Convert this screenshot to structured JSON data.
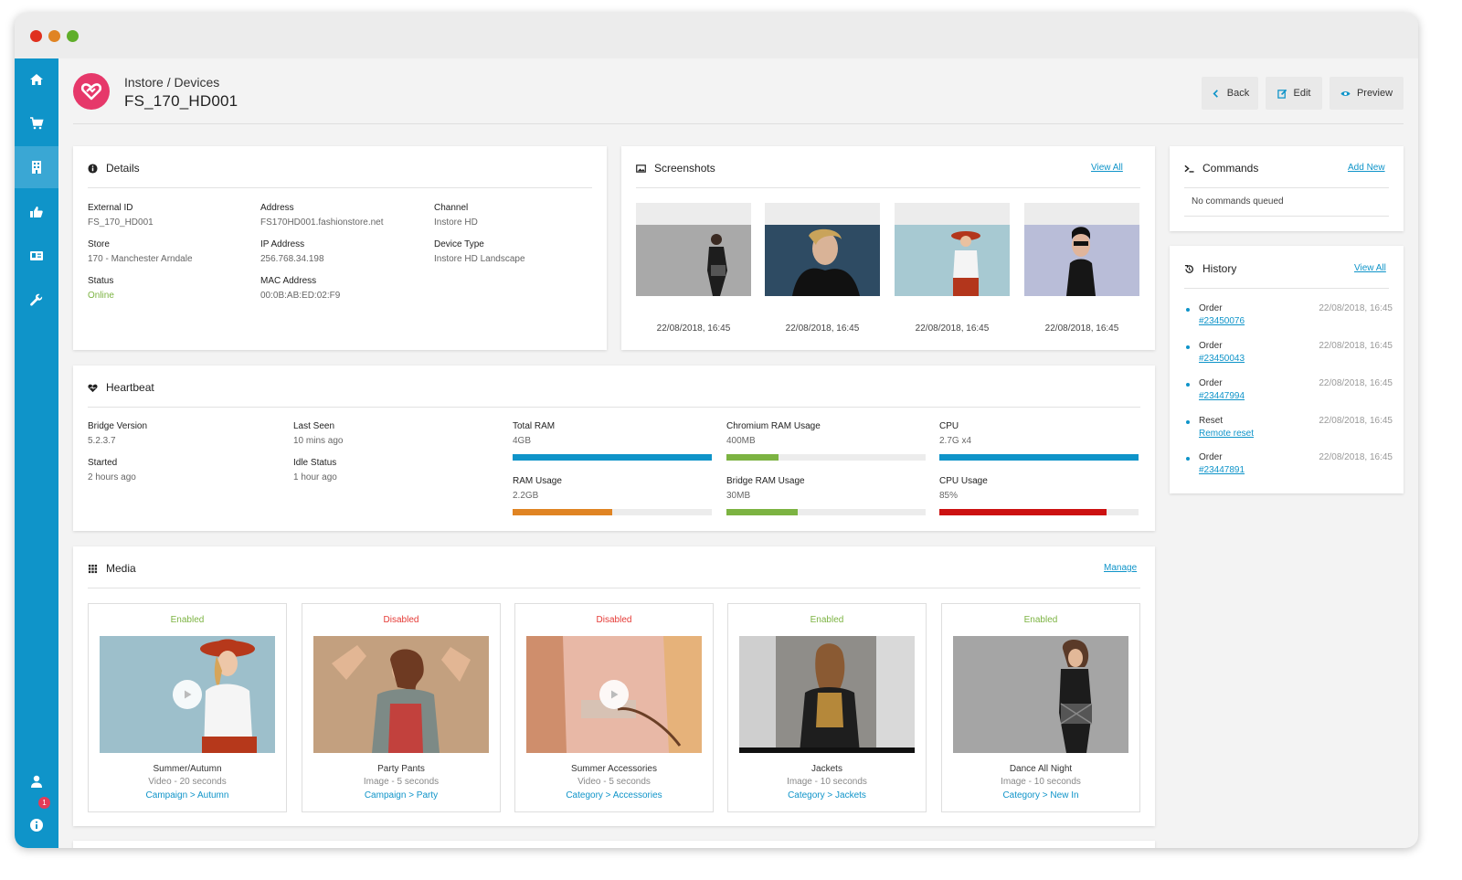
{
  "colors": {
    "accent": "#0f94c9",
    "brand": "#e6386a",
    "enabled": "#7cb342",
    "disabled": "#e53935",
    "orange": "#e08423",
    "red": "#cc1111"
  },
  "header": {
    "breadcrumb": "Instore / Devices",
    "title": "FS_170_HD001",
    "back_label": "Back",
    "edit_label": "Edit",
    "preview_label": "Preview"
  },
  "details": {
    "title": "Details",
    "external_id_label": "External ID",
    "external_id": "FS_170_HD001",
    "address_label": "Address",
    "address": "FS170HD001.fashionstore.net",
    "channel_label": "Channel",
    "channel": "Instore HD",
    "store_label": "Store",
    "store": "170 - Manchester Arndale",
    "ip_label": "IP Address",
    "ip": "256.768.34.198",
    "device_type_label": "Device Type",
    "device_type": "Instore HD Landscape",
    "status_label": "Status",
    "status": "Online",
    "mac_label": "MAC Address",
    "mac": "00:0B:AB:ED:02:F9"
  },
  "screenshots": {
    "title": "Screenshots",
    "view_all": "View All",
    "items": [
      {
        "date": "22/08/2018, 16:45"
      },
      {
        "date": "22/08/2018, 16:45"
      },
      {
        "date": "22/08/2018, 16:45"
      },
      {
        "date": "22/08/2018, 16:45"
      }
    ]
  },
  "commands": {
    "title": "Commands",
    "add_new": "Add New",
    "empty": "No commands queued"
  },
  "history": {
    "title": "History",
    "view_all": "View All",
    "items": [
      {
        "type": "Order",
        "ref": "#23450076",
        "time": "22/08/2018, 16:45"
      },
      {
        "type": "Order",
        "ref": "#23450043",
        "time": "22/08/2018, 16:45"
      },
      {
        "type": "Order",
        "ref": "#23447994",
        "time": "22/08/2018, 16:45"
      },
      {
        "type": "Reset",
        "ref": "Remote reset",
        "time": "22/08/2018, 16:45"
      },
      {
        "type": "Order",
        "ref": "#23447891",
        "time": "22/08/2018, 16:45"
      }
    ]
  },
  "heartbeat": {
    "title": "Heartbeat",
    "bridge_version_label": "Bridge Version",
    "bridge_version": "5.2.3.7",
    "last_seen_label": "Last Seen",
    "last_seen": "10 mins ago",
    "started_label": "Started",
    "started": "2 hours ago",
    "idle_label": "Idle Status",
    "idle": "1 hour ago",
    "total_ram_label": "Total RAM",
    "total_ram": "4GB",
    "total_ram_fill": 1.0,
    "chromium_label": "Chromium RAM Usage",
    "chromium": "400MB",
    "chromium_fill": 0.26,
    "cpu_label": "CPU",
    "cpu": "2.7G x4",
    "cpu_fill": 1.0,
    "ram_usage_label": "RAM Usage",
    "ram_usage": "2.2GB",
    "ram_usage_fill": 0.5,
    "bridge_ram_label": "Bridge RAM Usage",
    "bridge_ram": "30MB",
    "bridge_ram_fill": 0.36,
    "cpu_usage_label": "CPU Usage",
    "cpu_usage": "85%",
    "cpu_usage_fill": 0.84
  },
  "media": {
    "title": "Media",
    "manage": "Manage",
    "items": [
      {
        "status": "Enabled",
        "name": "Summer/Autumn",
        "meta": "Video - 20 seconds",
        "category": "Campaign > Autumn"
      },
      {
        "status": "Disabled",
        "name": "Party Pants",
        "meta": "Image - 5 seconds",
        "category": "Campaign > Party"
      },
      {
        "status": "Disabled",
        "name": "Summer Accessories",
        "meta": "Video - 5 seconds",
        "category": "Category > Accessories"
      },
      {
        "status": "Enabled",
        "name": "Jackets",
        "meta": "Image - 10 seconds",
        "category": "Category > Jackets"
      },
      {
        "status": "Enabled",
        "name": "Dance All Night",
        "meta": "Image - 10 seconds",
        "category": "Category > New In"
      }
    ]
  },
  "sidebar": {
    "notification_count": "1"
  }
}
